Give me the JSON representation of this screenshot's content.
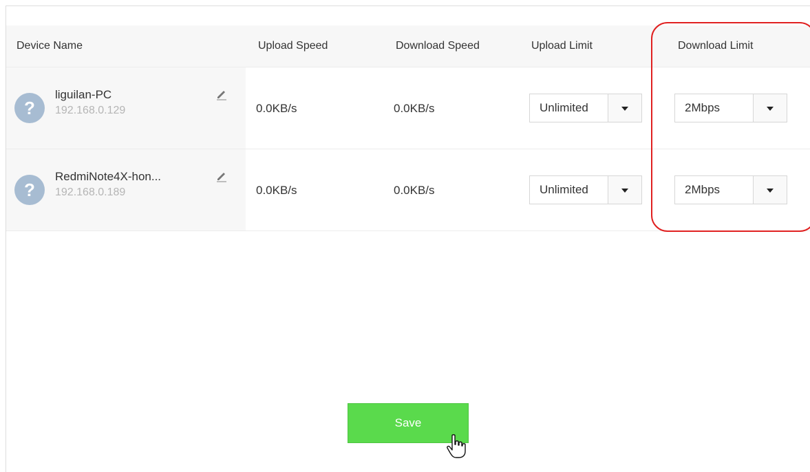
{
  "table": {
    "headers": {
      "device_name": "Device Name",
      "upload_speed": "Upload Speed",
      "download_speed": "Download Speed",
      "upload_limit": "Upload Limit",
      "download_limit": "Download Limit"
    },
    "rows": [
      {
        "avatar_glyph": "?",
        "name": "liguilan-PC",
        "ip": "192.168.0.129",
        "upload_speed": "0.0KB/s",
        "download_speed": "0.0KB/s",
        "upload_limit": "Unlimited",
        "download_limit": "2Mbps"
      },
      {
        "avatar_glyph": "?",
        "name": "RedmiNote4X-hon...",
        "ip": "192.168.0.189",
        "upload_speed": "0.0KB/s",
        "download_speed": "0.0KB/s",
        "upload_limit": "Unlimited",
        "download_limit": "2Mbps"
      }
    ]
  },
  "actions": {
    "save_label": "Save"
  },
  "colors": {
    "save_button": "#5ada4c",
    "highlight_outline": "#e02020",
    "avatar": "#a7bcd2"
  },
  "icons": {
    "edit": "pencil-icon",
    "dropdown": "caret-down-icon",
    "avatar": "question-mark-icon",
    "cursor": "hand-pointer-icon"
  }
}
